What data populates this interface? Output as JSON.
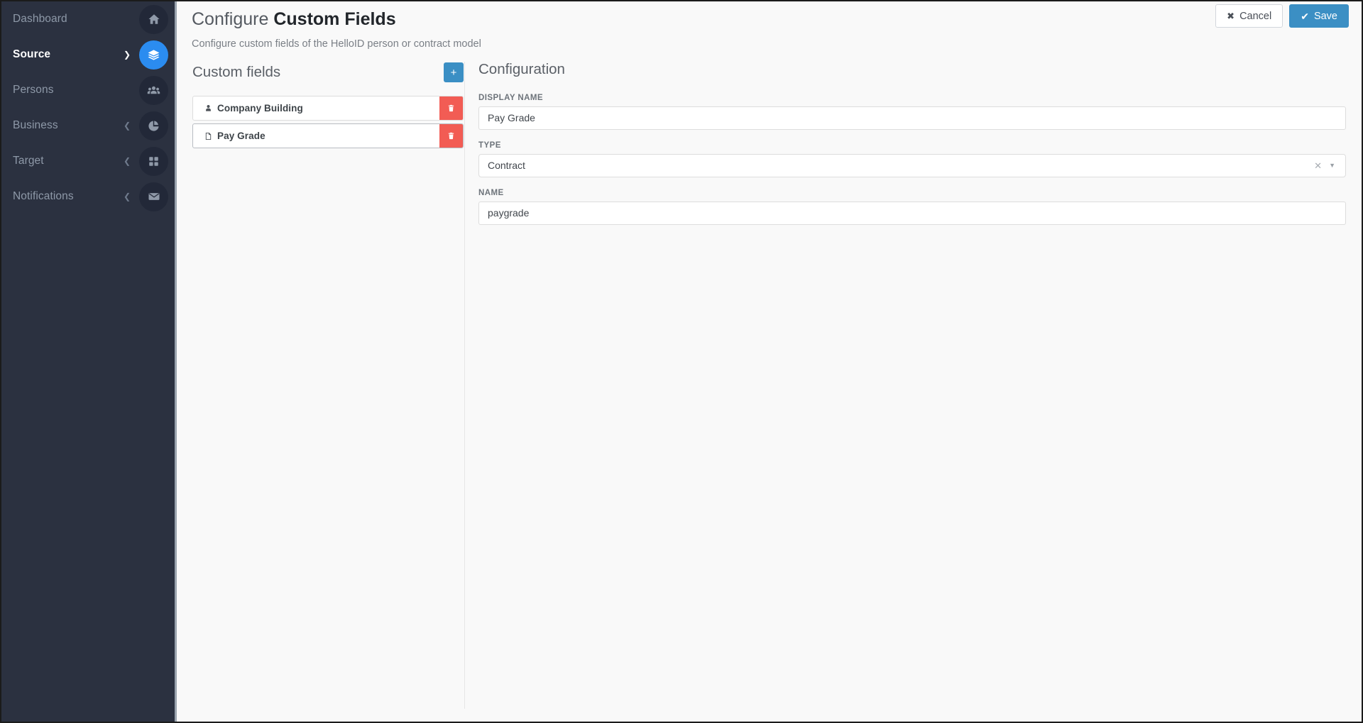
{
  "sidebar": {
    "items": [
      {
        "label": "Dashboard",
        "icon": "home-icon",
        "active": false,
        "caret": ""
      },
      {
        "label": "Source",
        "icon": "layers-icon",
        "active": true,
        "caret": "chevron-down-icon"
      },
      {
        "label": "Persons",
        "icon": "users-icon",
        "active": false,
        "caret": ""
      },
      {
        "label": "Business",
        "icon": "pie-chart-icon",
        "active": false,
        "caret": "chevron-left-icon"
      },
      {
        "label": "Target",
        "icon": "grid-icon",
        "active": false,
        "caret": "chevron-left-icon"
      },
      {
        "label": "Notifications",
        "icon": "envelope-icon",
        "active": false,
        "caret": "chevron-left-icon"
      }
    ]
  },
  "topbar": {
    "cancel_label": "Cancel",
    "cancel_icon": "close-icon",
    "save_label": "Save",
    "save_icon": "check-icon"
  },
  "header": {
    "title_prefix": "Configure ",
    "title_strong": "Custom Fields",
    "subtitle": "Configure custom fields of the HelloID person or contract model"
  },
  "custom_fields": {
    "section_title": "Custom fields",
    "add_button_icon": "plus-icon",
    "add_button_label": "+",
    "items": [
      {
        "label": "Company Building",
        "icon": "person-icon",
        "delete_icon": "trash-icon",
        "selected": false
      },
      {
        "label": "Pay Grade",
        "icon": "document-icon",
        "delete_icon": "trash-icon",
        "selected": true
      }
    ]
  },
  "configuration": {
    "section_title": "Configuration",
    "display_name": {
      "label": "DISPLAY NAME",
      "value": "Pay Grade"
    },
    "type": {
      "label": "TYPE",
      "value": "Contract",
      "clear_icon": "close-icon",
      "arrow_icon": "caret-down-icon"
    },
    "name": {
      "label": "NAME",
      "value": "paygrade"
    }
  },
  "colors": {
    "sidebar_bg": "#2b3140",
    "accent_blue": "#3b8fc4",
    "active_blue": "#2b8cf0",
    "danger_red": "#f25c54",
    "page_bg": "#f9f9f9"
  }
}
